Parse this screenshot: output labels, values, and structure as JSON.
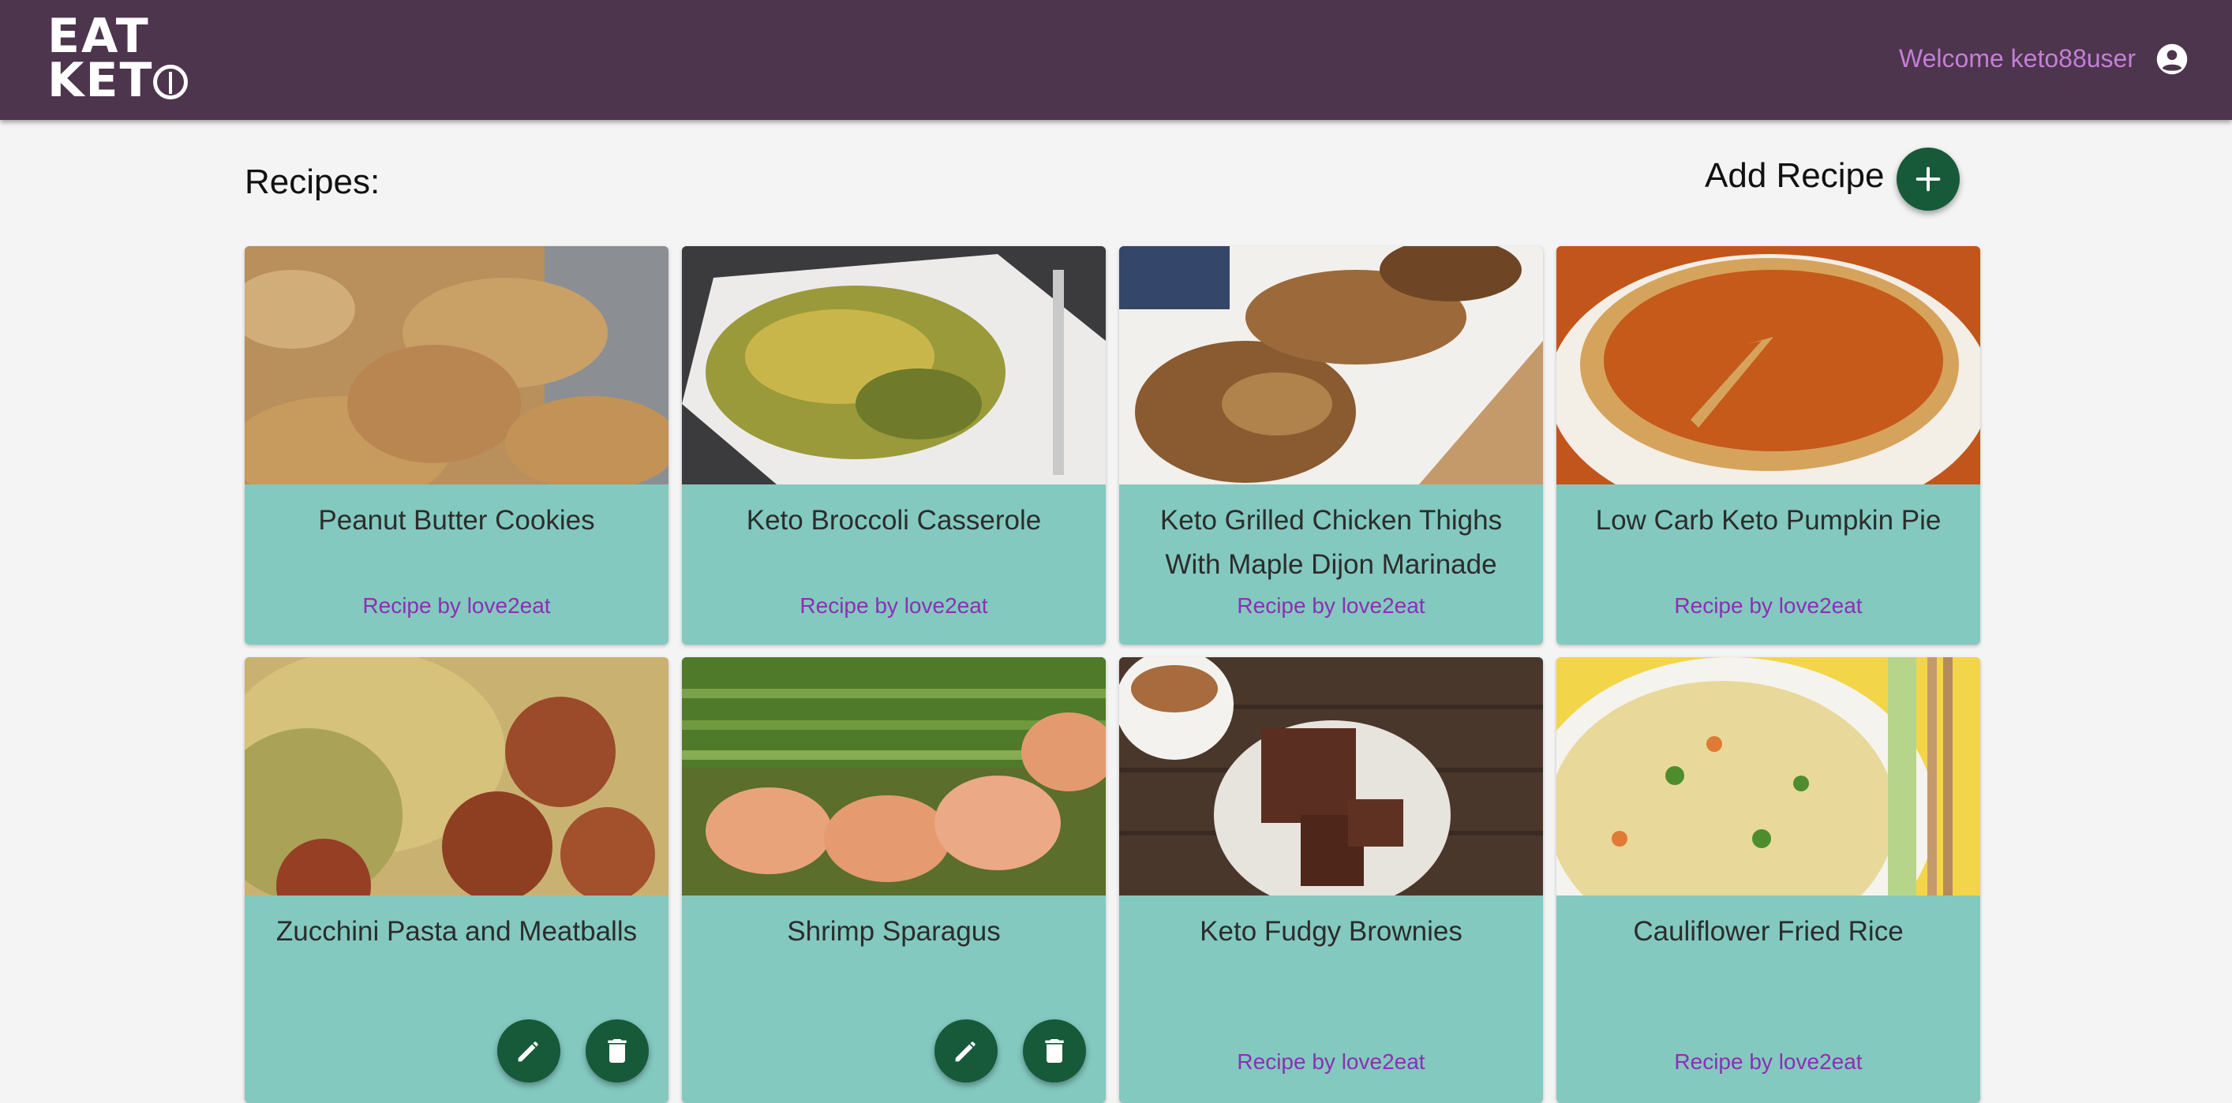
{
  "header": {
    "logo_line1": "EAT",
    "logo_line2_prefix": "KET",
    "welcome_text": "Welcome keto88user",
    "user_icon": "account-circle-icon"
  },
  "main": {
    "title": "Recipes:",
    "add_label": "Add Recipe",
    "add_icon": "plus-icon"
  },
  "recipes": [
    {
      "title": "Peanut Butter Cookies",
      "author": "Recipe by love2eat"
    },
    {
      "title": "Keto Broccoli Casserole",
      "author": "Recipe by love2eat"
    },
    {
      "title": "Keto Grilled Chicken Thighs With Maple Dijon Marinade",
      "author": "Recipe by love2eat"
    },
    {
      "title": "Low Carb Keto Pumpkin Pie",
      "author": "Recipe by love2eat"
    },
    {
      "title": "Zucchini Pasta and Meatballs",
      "author": "",
      "actions": [
        "edit-icon",
        "delete-icon"
      ]
    },
    {
      "title": "Shrimp Sparagus",
      "author": "",
      "actions": [
        "edit-icon",
        "delete-icon"
      ]
    },
    {
      "title": "Keto Fudgy Brownies",
      "author": "Recipe by love2eat"
    },
    {
      "title": "Cauliflower Fried Rice",
      "author": "Recipe by love2eat"
    }
  ],
  "colors": {
    "header_bg": "#4d354d",
    "card_bg": "#83c9c0",
    "accent_green": "#175a3a",
    "author_purple": "#8d2fb3",
    "welcome_purple": "#c47fd6"
  }
}
